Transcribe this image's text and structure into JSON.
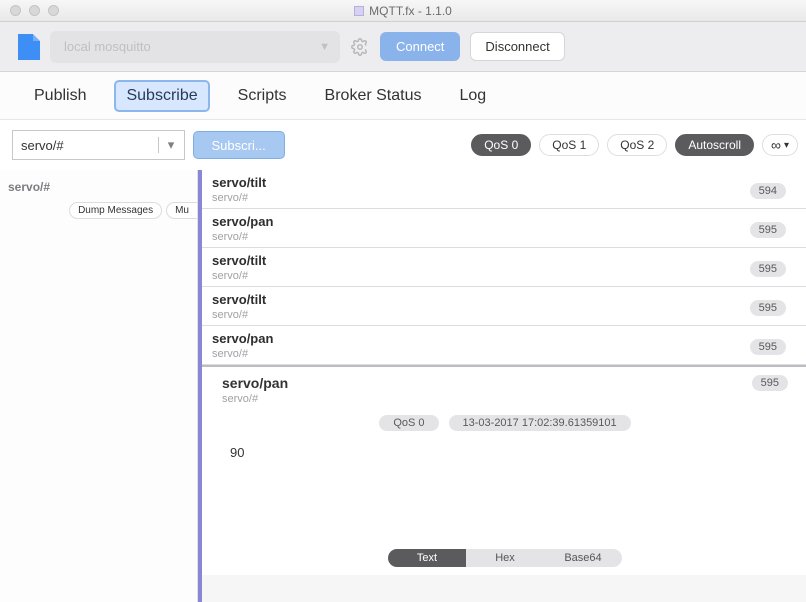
{
  "window": {
    "title": "MQTT.fx - 1.1.0"
  },
  "toolbar": {
    "profile": "local mosquitto",
    "connect": "Connect",
    "disconnect": "Disconnect"
  },
  "tabs": [
    "Publish",
    "Subscribe",
    "Scripts",
    "Broker Status",
    "Log"
  ],
  "subbar": {
    "topic": "servo/#",
    "subscribe": "Subscri...",
    "qos": [
      "QoS 0",
      "QoS 1",
      "QoS 2"
    ],
    "autoscroll": "Autoscroll"
  },
  "sidebar": {
    "topic": "servo/#",
    "dump": "Dump Messages",
    "mute": "Mu"
  },
  "messages": [
    {
      "topic": "servo/tilt",
      "sub": "servo/#",
      "id": "594"
    },
    {
      "topic": "servo/pan",
      "sub": "servo/#",
      "id": "595"
    },
    {
      "topic": "servo/tilt",
      "sub": "servo/#",
      "id": "595"
    },
    {
      "topic": "servo/tilt",
      "sub": "servo/#",
      "id": "595"
    },
    {
      "topic": "servo/pan",
      "sub": "servo/#",
      "id": "595"
    }
  ],
  "detail": {
    "topic": "servo/pan",
    "sub": "servo/#",
    "id": "595",
    "qos": "QoS 0",
    "time": "13-03-2017  17:02:39.61359101",
    "payload": "90",
    "formats": [
      "Text",
      "Hex",
      "Base64"
    ]
  }
}
